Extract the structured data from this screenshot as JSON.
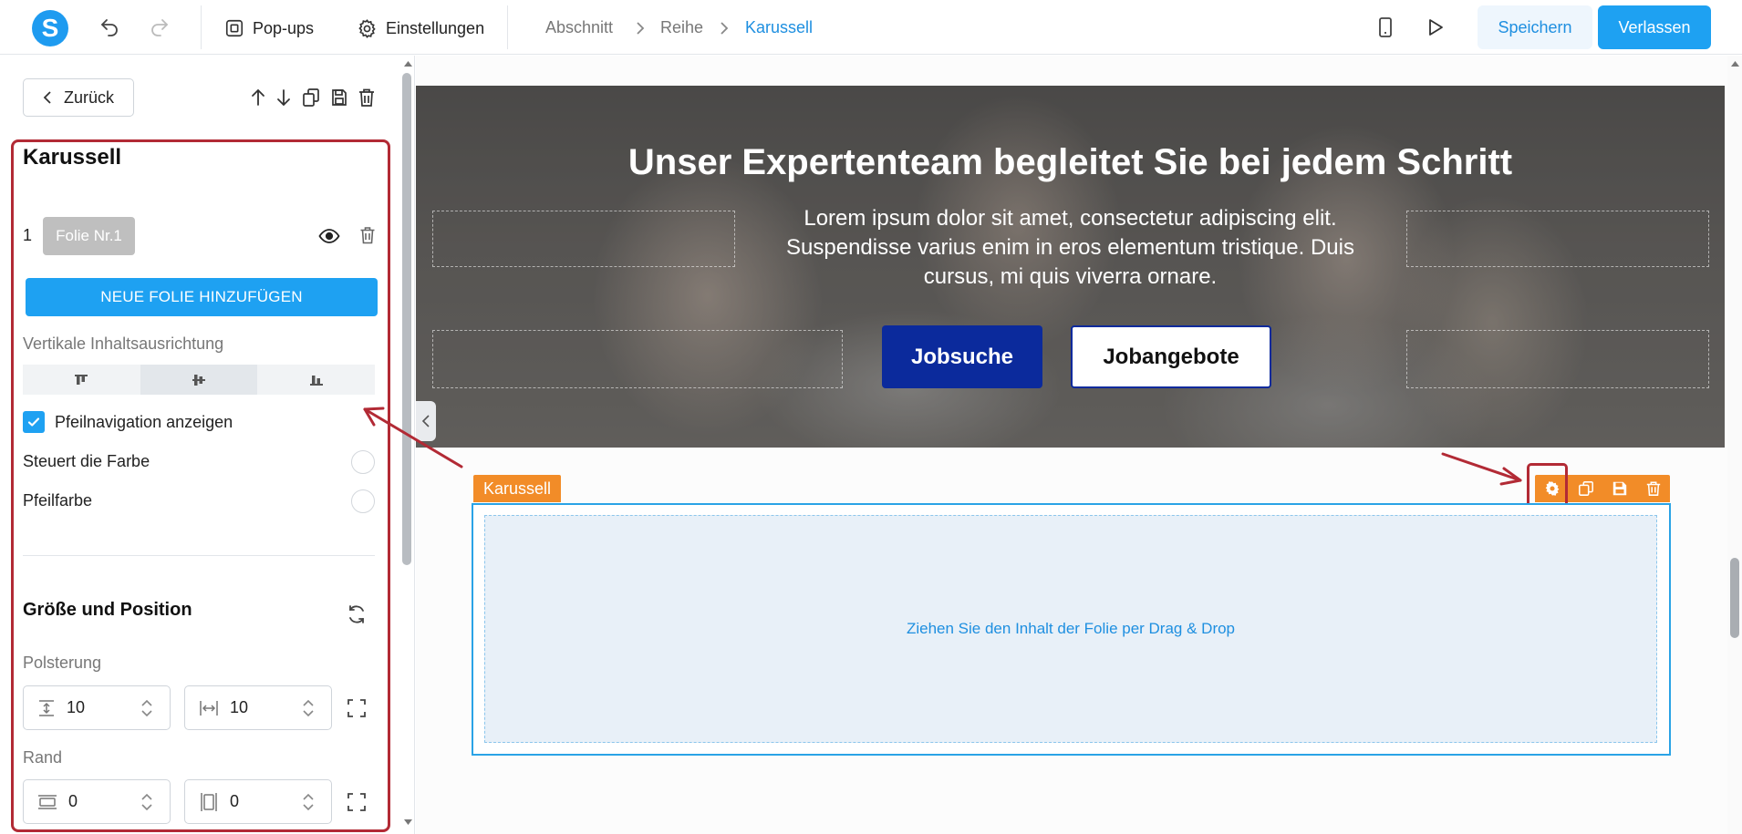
{
  "topbar": {
    "logo_letter": "S",
    "popups_label": "Pop-ups",
    "settings_label": "Einstellungen",
    "breadcrumb": [
      "Abschnitt",
      "Reihe",
      "Karussell"
    ],
    "save_label": "Speichern",
    "exit_label": "Verlassen"
  },
  "left_panel": {
    "back_label": "Zurück",
    "title": "Karussell",
    "slide": {
      "number": "1",
      "name": "Folie Nr.1"
    },
    "add_slide_label": "NEUE FOLIE HINZUFÜGEN",
    "vertical_align_label": "Vertikale Inhaltsausrichtung",
    "arrow_nav_label": "Pfeilnavigation anzeigen",
    "arrow_nav_checked": true,
    "color_control_label": "Steuert die Farbe",
    "arrow_color_label": "Pfeilfarbe",
    "size_position_title": "Größe und Position",
    "padding_label": "Polsterung",
    "padding_vertical": "10",
    "padding_horizontal": "10",
    "border_label": "Rand",
    "border_top": "0",
    "border_side": "0"
  },
  "hero": {
    "title": "Unser Expertenteam begleitet Sie bei jedem Schritt",
    "text": "Lorem ipsum dolor sit amet, consectetur adipiscing elit. Suspendisse varius enim in eros elementum tristique. Duis cursus, mi quis viverra ornare.",
    "button_primary": "Jobsuche",
    "button_secondary": "Jobangebote"
  },
  "carousel": {
    "tag_label": "Karussell",
    "drop_hint": "Ziehen Sie den Inhalt der Folie per Drag & Drop"
  },
  "colors": {
    "accent": "#1ea1f2",
    "element_toolbar": "#f28c28",
    "annotation_red": "#b22a35",
    "hero_primary_button": "#0b2a9c"
  }
}
